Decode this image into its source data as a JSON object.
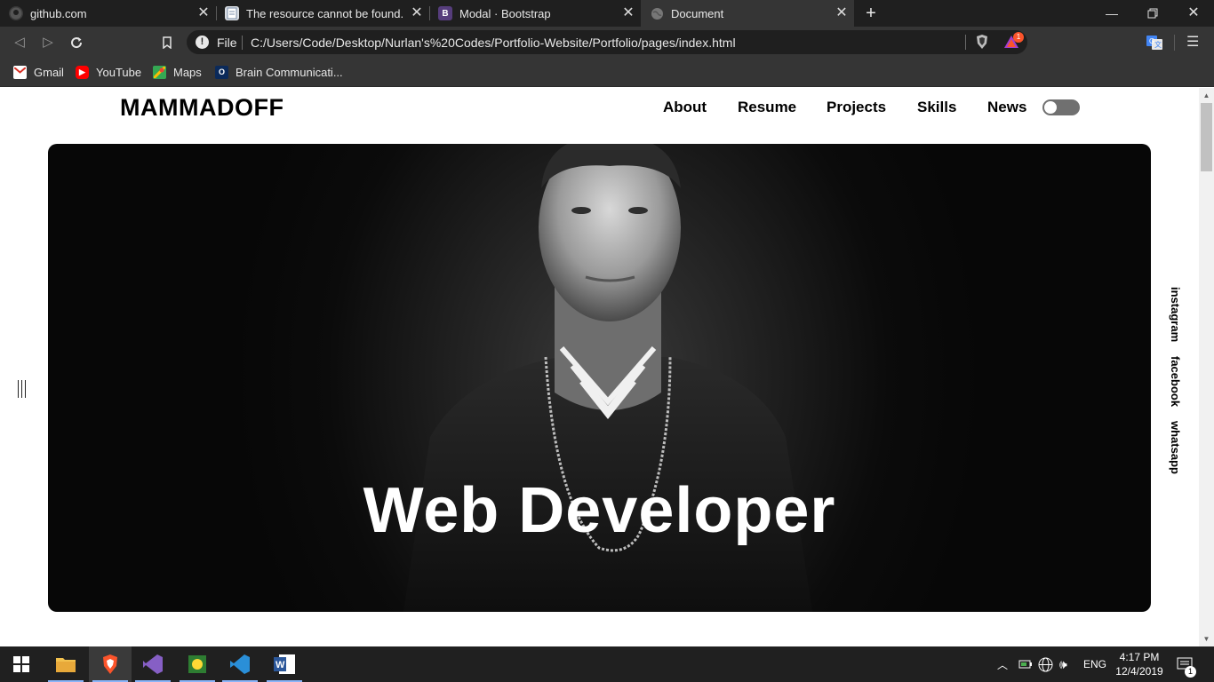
{
  "browser": {
    "tabs": [
      {
        "title": "github.com",
        "icon": "github-icon",
        "active": false
      },
      {
        "title": "The resource cannot be found.",
        "icon": "page-icon",
        "active": false
      },
      {
        "title": "Modal · Bootstrap",
        "icon": "bootstrap-icon",
        "active": false
      },
      {
        "title": "Document",
        "icon": "globe-icon",
        "active": true
      }
    ],
    "address": {
      "scheme": "File",
      "url": "C:/Users/Code/Desktop/Nurlan's%20Codes/Portfolio-Website/Portfolio/pages/index.html"
    },
    "badge_count": "1",
    "bookmarks": [
      {
        "label": "Gmail",
        "icon": "gmail-icon"
      },
      {
        "label": "YouTube",
        "icon": "youtube-icon"
      },
      {
        "label": "Maps",
        "icon": "maps-icon"
      },
      {
        "label": "Brain Communicati...",
        "icon": "brain-icon"
      }
    ]
  },
  "page": {
    "logo": "MAMMADOFF",
    "nav": [
      "About",
      "Resume",
      "Projects",
      "Skills",
      "News"
    ],
    "theme_toggle_on": false,
    "hero_title": "Web Developer",
    "social": [
      "instagram",
      "facebook",
      "whatsapp"
    ]
  },
  "taskbar": {
    "apps": [
      "explorer",
      "brave",
      "visual-studio",
      "gitkraken",
      "vscode",
      "word"
    ],
    "language": "ENG",
    "time": "4:17 PM",
    "date": "12/4/2019",
    "notifications": "1"
  },
  "colors": {
    "tab_strip": "#1f1f1f",
    "toolbar": "#353535",
    "hero_bg": "#0b0b0b",
    "taskbar": "#202020"
  }
}
